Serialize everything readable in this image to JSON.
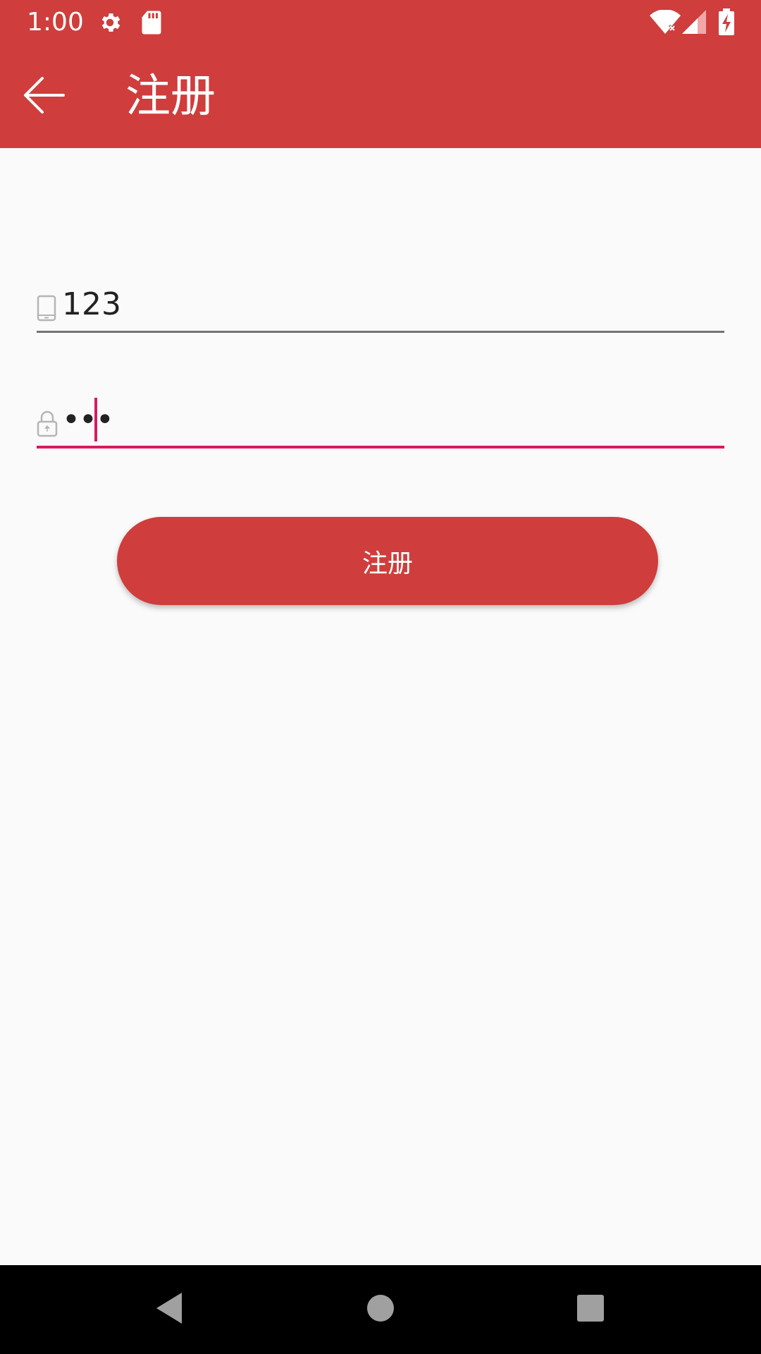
{
  "status_bar": {
    "time": "1:00",
    "icons": [
      "settings-icon",
      "sd-card-icon",
      "wifi-off-icon",
      "signal-icon",
      "battery-charging-icon"
    ]
  },
  "toolbar": {
    "title": "注册",
    "back_icon": "arrow-back-icon"
  },
  "form": {
    "phone": {
      "value": "123",
      "icon": "phone-icon"
    },
    "password": {
      "masked_value": "•••",
      "icon": "lock-icon"
    },
    "submit_label": "注册"
  },
  "colors": {
    "primary": "#cf3d3c",
    "accent": "#d81b60",
    "background": "#fafafa"
  },
  "nav_bar": {
    "icons": [
      "back-triangle-icon",
      "home-circle-icon",
      "recents-square-icon"
    ]
  }
}
